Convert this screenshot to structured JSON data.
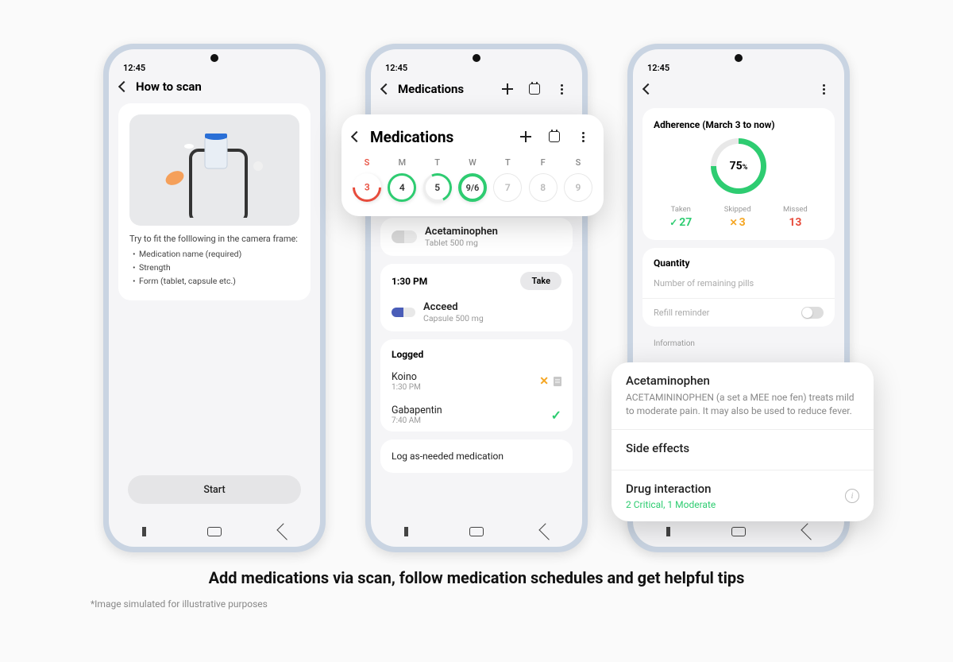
{
  "status_time": "12:45",
  "phone1": {
    "title": "How to scan",
    "try": "Try to fit the folllowing in the camera frame:",
    "b1": "Medication name (required)",
    "b2": "Strength",
    "b3": "Form (tablet, capsule etc.)",
    "start": "Start"
  },
  "phone2": {
    "title": "Medications",
    "days": [
      "S",
      "M",
      "T",
      "W",
      "T",
      "F",
      "S"
    ],
    "nums": [
      "3",
      "4",
      "5",
      "9/6",
      "7",
      "8",
      "9"
    ],
    "med1_name": "Acetaminophen",
    "med1_sub": "Tablet 500 mg",
    "time2": "1:30 PM",
    "take": "Take",
    "med2_name": "Acceed",
    "med2_sub": "Capsule 500 mg",
    "logged": "Logged",
    "log1_name": "Koino",
    "log1_time": "1:30 PM",
    "log2_name": "Gabapentin",
    "log2_time": "7:40 AM",
    "asneeded": "Log as-needed medication"
  },
  "phone3": {
    "adh_title": "Adherence (March 3 to now)",
    "pct": "75",
    "pct_unit": "%",
    "taken_label": "Taken",
    "taken_val": "27",
    "skipped_label": "Skipped",
    "skipped_val": "3",
    "missed_label": "Missed",
    "missed_val": "13",
    "qty": "Quantity",
    "qty_sub": "Number of remaining pills",
    "refill": "Refill reminder",
    "info": "Information"
  },
  "info_card": {
    "h1": "Acetaminophen",
    "p1": "ACETAMININOPHEN (a set a MEE noe fen) treats mild to moderate pain. It may also be used to reduce fever.",
    "h2": "Side effects",
    "h3": "Drug interaction",
    "di": "2 Critical, 1 Moderate"
  },
  "caption": "Add medications via scan, follow medication schedules and get helpful tips",
  "disclaimer": "*Image simulated for illustrative purposes"
}
